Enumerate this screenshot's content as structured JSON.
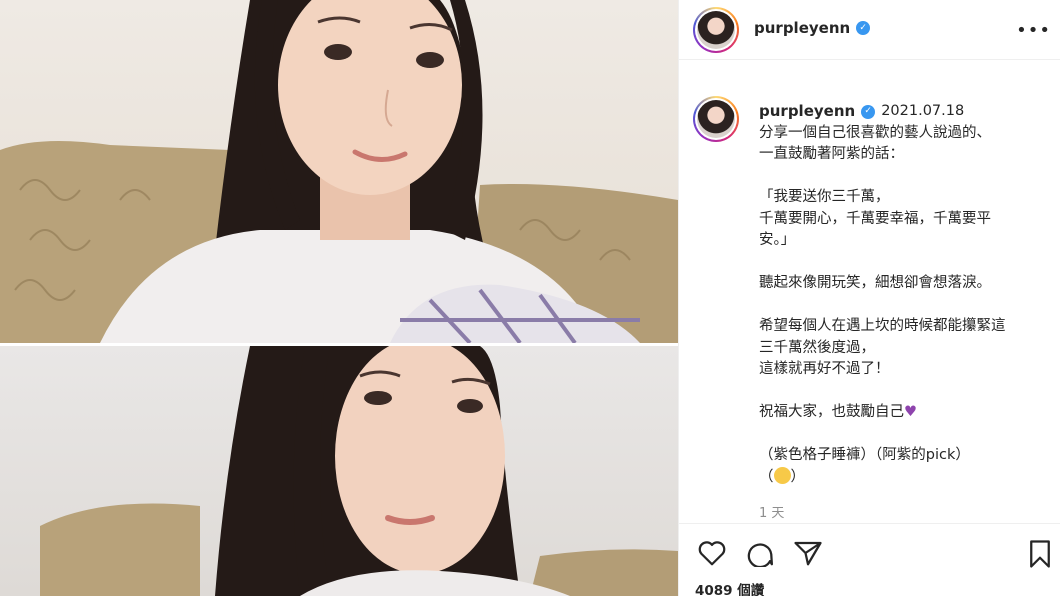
{
  "post": {
    "username": "purpleyenn",
    "verified_icon": "verified-check-icon",
    "date": "2021.07.18",
    "caption_lines": [
      "分享一個自己很喜歡的藝人說過的、",
      "一直鼓勵著阿紫的話：",
      "",
      "「我要送你三千萬，",
      "千萬要開心，千萬要幸福，千萬要平",
      "安。」",
      "",
      "聽起來像開玩笑，細想卻會想落淚。",
      "",
      "希望每個人在遇上坎的時候都能攥緊這",
      "三千萬然後度過，",
      "這樣就再好不過了！",
      "",
      "祝福大家，也鼓勵自己",
      "",
      "（紫色格子睡褲）（阿紫的pick）",
      "（"
    ],
    "caption_suffix_close": "）",
    "time_ago": "1 天",
    "views": "4089 個讚"
  },
  "icons": {
    "more": "more-options-icon",
    "like": "heart-icon",
    "comment": "comment-icon",
    "share": "paper-plane-icon",
    "save": "bookmark-icon"
  },
  "colors": {
    "verified": "#3897f0",
    "text": "#262626",
    "muted": "#8e8e8e",
    "heart_emoji": "#8e44ad"
  }
}
